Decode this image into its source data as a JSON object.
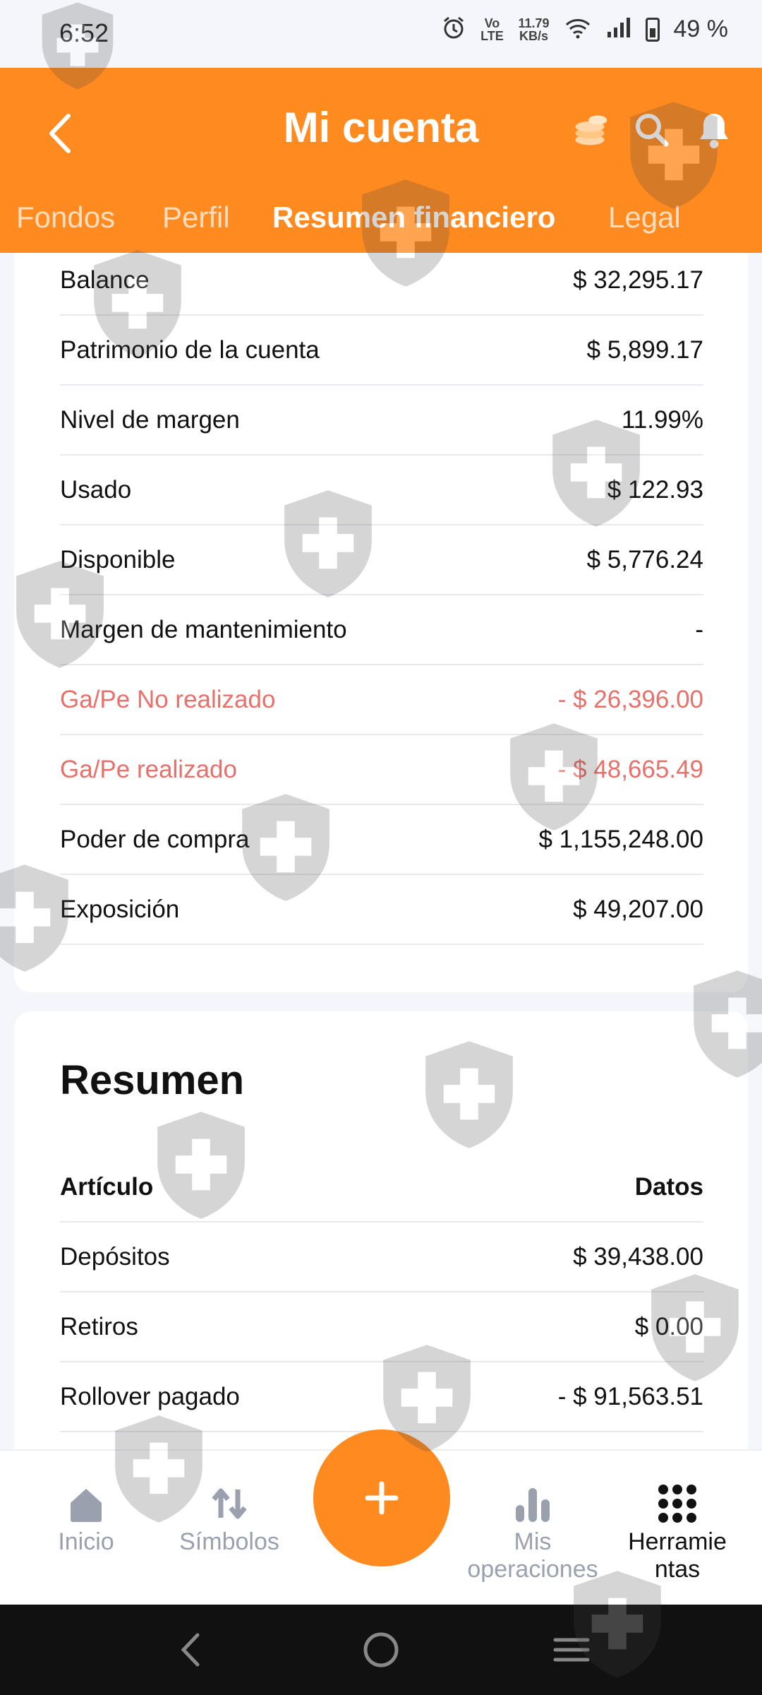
{
  "status_bar": {
    "time": "6:52",
    "volte": "Vo LTE",
    "net_speed_value": "11.79",
    "net_speed_unit": "KB/s",
    "battery": "49 %"
  },
  "header": {
    "title": "Mi cuenta",
    "tabs": [
      {
        "label": "Fondos"
      },
      {
        "label": "Perfil"
      },
      {
        "label": "Resumen financiero"
      },
      {
        "label": "Legal"
      }
    ],
    "active_tab": "Resumen financiero",
    "accent_color": "#ff8a1f"
  },
  "account_rows": [
    {
      "label": "Balance",
      "value": "$ 32,295.17"
    },
    {
      "label": "Patrimonio de la cuenta",
      "value": "$ 5,899.17"
    },
    {
      "label": "Nivel de margen",
      "value": "11.99%"
    },
    {
      "label": "Usado",
      "value": "$ 122.93"
    },
    {
      "label": "Disponible",
      "value": "$ 5,776.24"
    },
    {
      "label": "Margen de mantenimiento",
      "value": "-"
    },
    {
      "label": "Ga/Pe No realizado",
      "value": "- $ 26,396.00"
    },
    {
      "label": "Ga/Pe realizado",
      "value": "- $ 48,665.49"
    },
    {
      "label": "Poder de compra",
      "value": "$ 1,155,248.00"
    },
    {
      "label": "Exposición",
      "value": "$ 49,207.00"
    }
  ],
  "resumen": {
    "title": "Resumen",
    "col_item": "Artículo",
    "col_data": "Datos",
    "rows": [
      {
        "label": "Depósitos",
        "value": "$ 39,438.00"
      },
      {
        "label": "Retiros",
        "value": "$ 0.00"
      },
      {
        "label": "Rollover pagado",
        "value": "- $ 91,563.51"
      }
    ]
  },
  "bottom_nav": {
    "home": "Inicio",
    "symbols": "Símbolos",
    "ops_line1": "Mis",
    "ops_line2": "operaciones",
    "tools_line1": "Herramie",
    "tools_line2": "ntas"
  },
  "colors": {
    "negative": "#e8706a",
    "nav_inactive": "#9aa0ad"
  }
}
